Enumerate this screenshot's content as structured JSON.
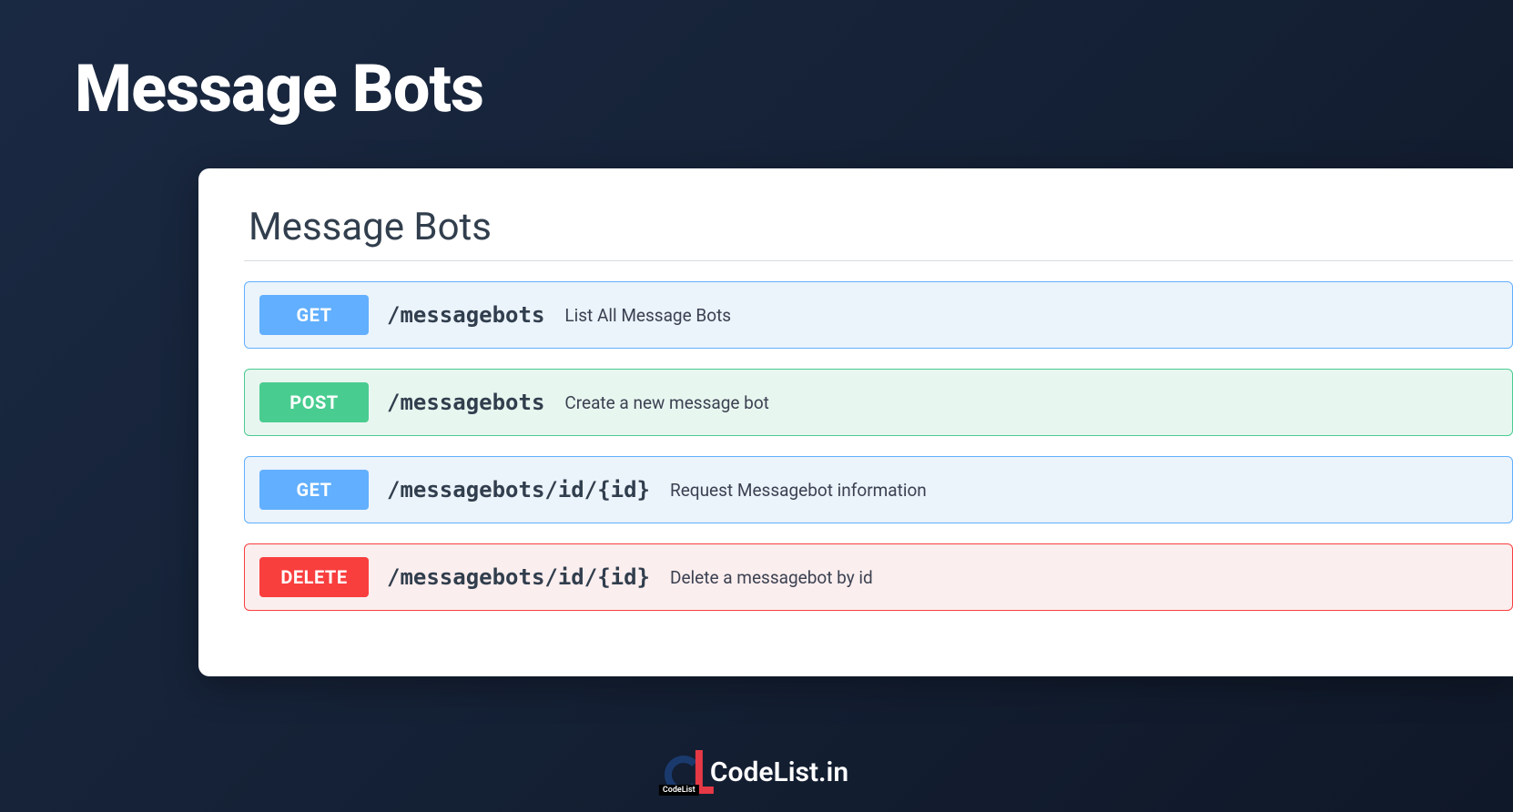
{
  "page": {
    "title": "Message Bots"
  },
  "panel": {
    "section_title": "Message Bots"
  },
  "endpoints": [
    {
      "method": "GET",
      "path": "/messagebots",
      "description": "List All Message Bots"
    },
    {
      "method": "POST",
      "path": "/messagebots",
      "description": "Create a new message bot"
    },
    {
      "method": "GET",
      "path": "/messagebots/id/{id}",
      "description": "Request Messagebot information"
    },
    {
      "method": "DELETE",
      "path": "/messagebots/id/{id}",
      "description": "Delete a messagebot by id"
    }
  ],
  "footer": {
    "logo_label": "CodeList",
    "brand_text": "CodeList.in"
  }
}
